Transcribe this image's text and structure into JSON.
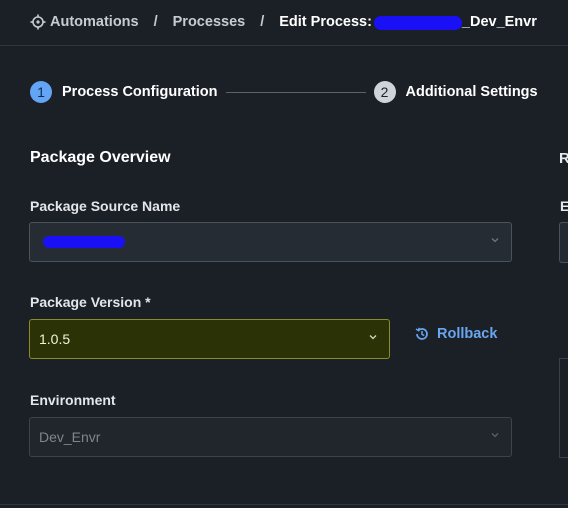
{
  "breadcrumb": {
    "items": [
      "Automations",
      "Processes"
    ],
    "separator": "/",
    "current_prefix": "Edit Process:",
    "current_suffix": "_Dev_Envr",
    "icon": "automation-gear-icon"
  },
  "stepper": {
    "steps": [
      {
        "number": "1",
        "label": "Process Configuration",
        "state": "active"
      },
      {
        "number": "2",
        "label": "Additional Settings",
        "state": "inactive"
      }
    ]
  },
  "section": {
    "title": "Package Overview"
  },
  "fields": {
    "package_source": {
      "label": "Package Source Name",
      "value": ""
    },
    "package_version": {
      "label": "Package Version *",
      "value": "1.0.5"
    },
    "environment": {
      "label": "Environment",
      "value": "Dev_Envr"
    }
  },
  "actions": {
    "rollback_label": "Rollback",
    "rollback_icon": "history-icon"
  },
  "right_panel": {
    "heading_initial": "R",
    "field_initial": "E"
  },
  "colors": {
    "background": "#1b2026",
    "accent": "#63a4f4",
    "link": "#6aa6f0",
    "highlight": "#2b3206",
    "redaction": "#1a10f5"
  }
}
